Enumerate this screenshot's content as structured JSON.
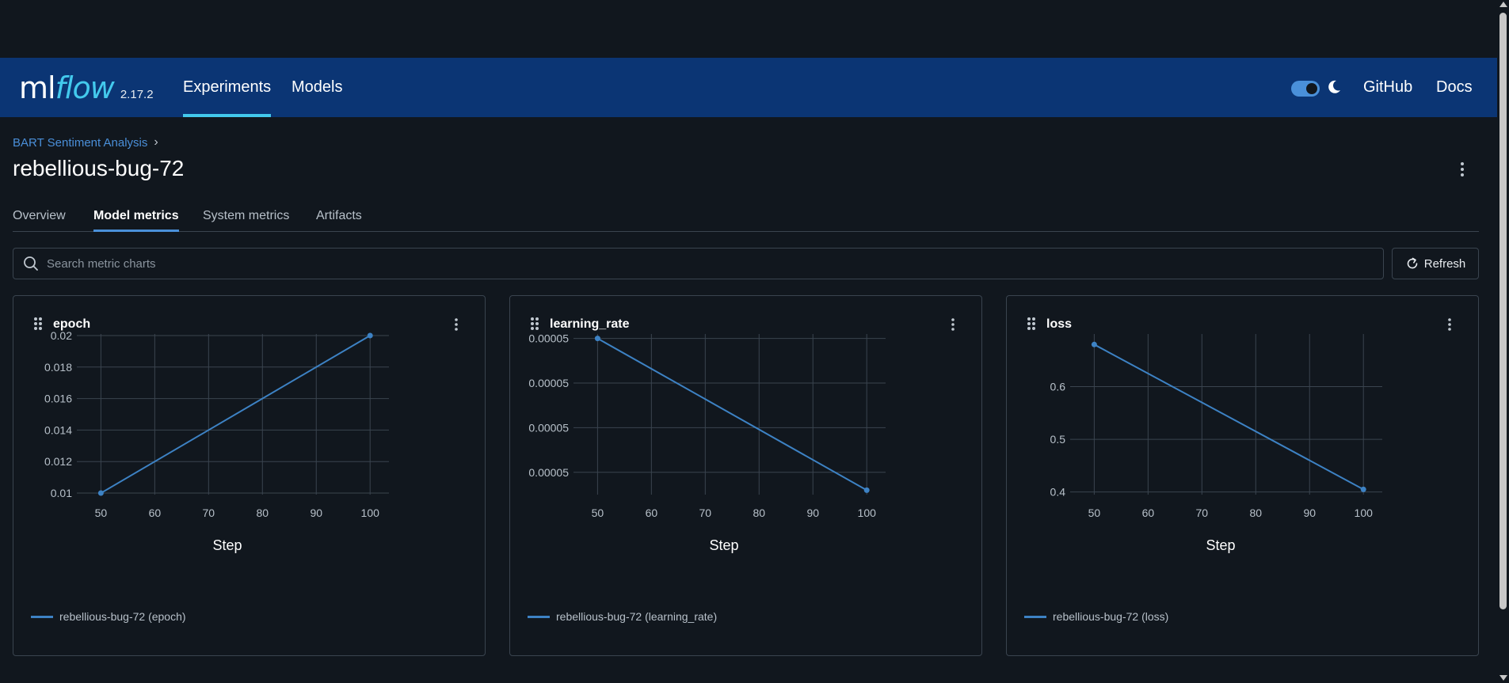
{
  "header": {
    "logo_ml": "ml",
    "logo_flow": "flow",
    "version": "2.17.2",
    "nav": [
      {
        "label": "Experiments",
        "active": true
      },
      {
        "label": "Models",
        "active": false
      }
    ],
    "github": "GitHub",
    "docs": "Docs",
    "theme_toggle": "dark"
  },
  "breadcrumb": {
    "experiment": "BART Sentiment Analysis",
    "separator": "›"
  },
  "page": {
    "title": "rebellious-bug-72"
  },
  "tabs": [
    {
      "label": "Overview",
      "active": false
    },
    {
      "label": "Model metrics",
      "active": true
    },
    {
      "label": "System metrics",
      "active": false
    },
    {
      "label": "Artifacts",
      "active": false
    }
  ],
  "search": {
    "placeholder": "Search metric charts",
    "value": ""
  },
  "refresh_label": "Refresh",
  "colors": {
    "header_bg": "#0b3574",
    "accent": "#43c9ed",
    "series": "#3d82c4",
    "background": "#11171e"
  },
  "chart_data": [
    {
      "type": "line",
      "title": "epoch",
      "xlabel": "Step",
      "ylabel": "",
      "x": [
        50,
        100
      ],
      "series": [
        {
          "name": "rebellious-bug-72 (epoch)",
          "values": [
            0.01,
            0.02
          ]
        }
      ],
      "xlim": [
        47,
        103.5
      ],
      "ylim": [
        0.0099,
        0.0201
      ],
      "xticks": [
        50,
        60,
        70,
        80,
        90,
        100
      ],
      "xtick_labels": [
        "50",
        "60",
        "70",
        "80",
        "90",
        "100"
      ],
      "yticks": [
        0.01,
        0.012,
        0.014,
        0.016,
        0.018,
        0.02
      ],
      "ytick_labels": [
        "0.01",
        "0.012",
        "0.014",
        "0.016",
        "0.018",
        "0.02"
      ],
      "grid": true,
      "legend": "bottom-left"
    },
    {
      "type": "line",
      "title": "learning_rate",
      "xlabel": "Step",
      "ylabel": "",
      "x": [
        50,
        100
      ],
      "series": [
        {
          "name": "rebellious-bug-72 (learning_rate)",
          "values": [
            4.97e-05,
            4.63e-05
          ]
        }
      ],
      "xlim": [
        47,
        103.5
      ],
      "ylim": [
        4.62e-05,
        4.98e-05
      ],
      "xticks": [
        50,
        60,
        70,
        80,
        90,
        100
      ],
      "xtick_labels": [
        "50",
        "60",
        "70",
        "80",
        "90",
        "100"
      ],
      "yticks": [
        4.97e-05,
        4.87e-05,
        4.77e-05,
        4.67e-05
      ],
      "ytick_labels": [
        "0.00005",
        "0.00005",
        "0.00005",
        "0.00005"
      ],
      "grid": true,
      "legend": "bottom-left"
    },
    {
      "type": "line",
      "title": "loss",
      "xlabel": "Step",
      "ylabel": "",
      "x": [
        50,
        100
      ],
      "series": [
        {
          "name": "rebellious-bug-72 (loss)",
          "values": [
            0.68,
            0.405
          ]
        }
      ],
      "xlim": [
        47,
        103.5
      ],
      "ylim": [
        0.395,
        0.7
      ],
      "xticks": [
        50,
        60,
        70,
        80,
        90,
        100
      ],
      "xtick_labels": [
        "50",
        "60",
        "70",
        "80",
        "90",
        "100"
      ],
      "yticks": [
        0.4,
        0.5,
        0.6
      ],
      "ytick_labels": [
        "0.4",
        "0.5",
        "0.6"
      ],
      "grid": true,
      "legend": "bottom-left"
    }
  ]
}
